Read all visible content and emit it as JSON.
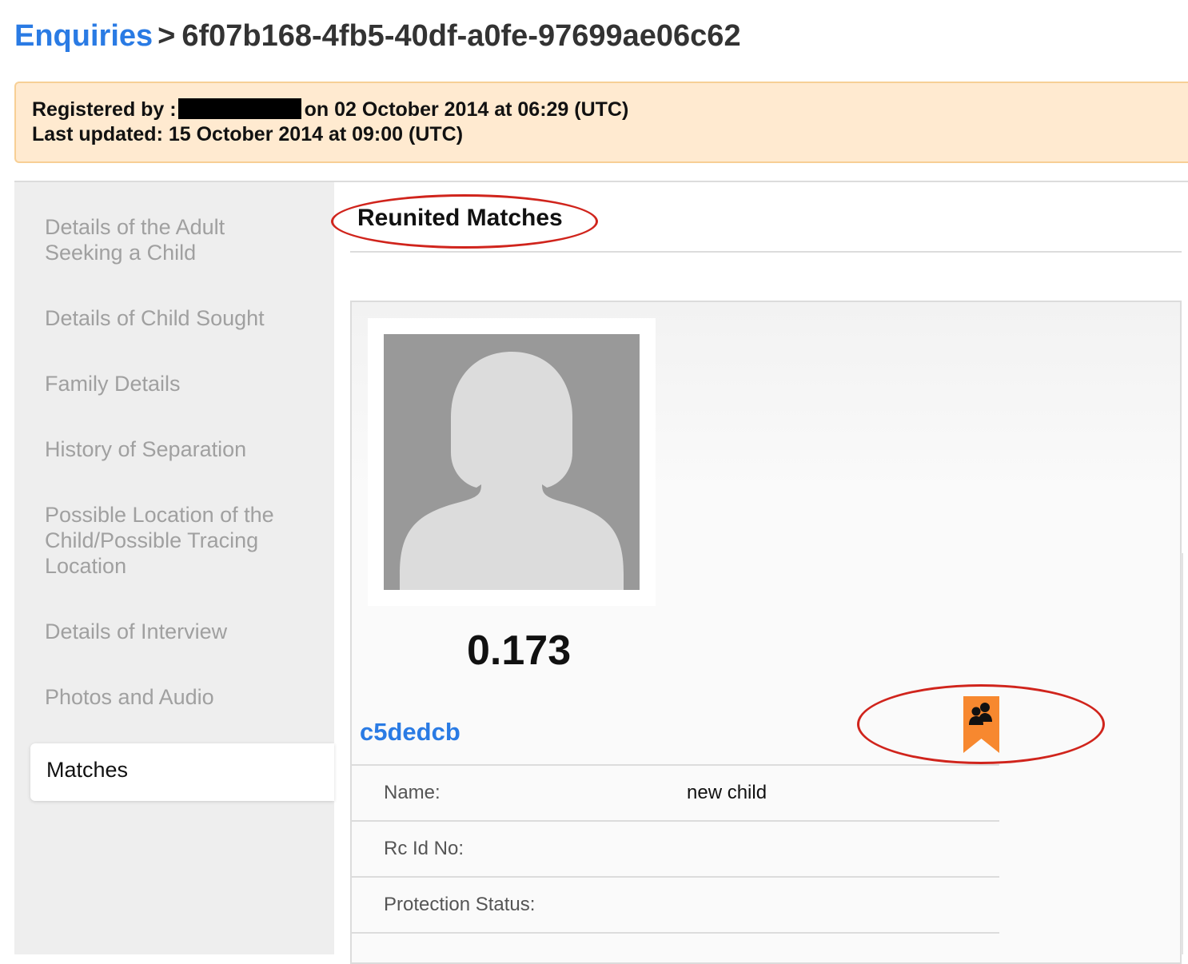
{
  "header": {
    "breadcrumb_link": "Enquiries",
    "separator": ">",
    "record_id": "6f07b168-4fb5-40df-a0fe-97699ae06c62"
  },
  "record_meta": {
    "registered_prefix": "Registered by :",
    "registered_suffix": "on 02 October 2014 at 06:29 (UTC)",
    "last_updated": "Last updated: 15 October 2014 at 09:00 (UTC)"
  },
  "sidebar": {
    "items": [
      {
        "label": "Details of the Adult Seeking a Child"
      },
      {
        "label": "Details of Child Sought"
      },
      {
        "label": "Family Details"
      },
      {
        "label": "History of Separation"
      },
      {
        "label": "Possible Location of the Child/Possible Tracing Location"
      },
      {
        "label": "Details of Interview"
      },
      {
        "label": "Photos and Audio"
      },
      {
        "label": "Matches"
      }
    ]
  },
  "main": {
    "section_title": "Reunited Matches",
    "match": {
      "score": "0.173",
      "id": "c5dedcb",
      "reunited_icon": "reunited-family-flag-icon",
      "fields": [
        {
          "label": "Name:",
          "value": "new child"
        },
        {
          "label": "Rc Id No:",
          "value": ""
        },
        {
          "label": "Protection Status:",
          "value": ""
        }
      ]
    }
  },
  "colors": {
    "link": "#2a7be4",
    "highlight_box": "#ffead0",
    "annotation": "#d0241c",
    "flag": "#f7882f"
  }
}
